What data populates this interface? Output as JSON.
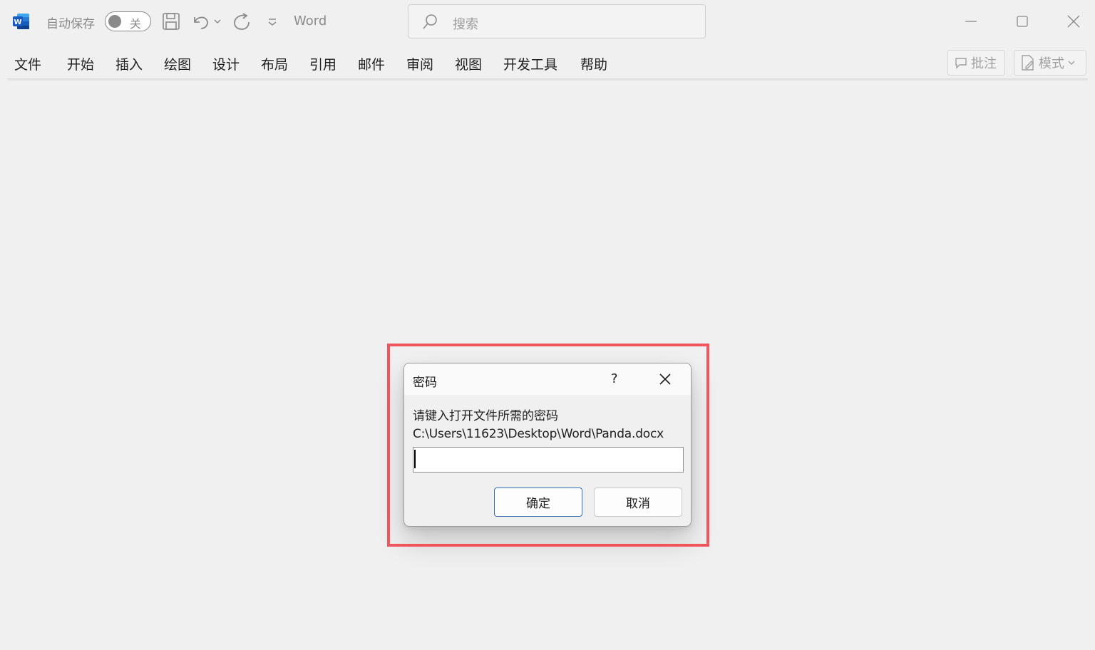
{
  "titlebar": {
    "autosave_label": "自动保存",
    "autosave_state": "关",
    "app_name": "Word",
    "search_placeholder": "搜索"
  },
  "tabs": [
    {
      "label": "文件"
    },
    {
      "label": "开始"
    },
    {
      "label": "插入"
    },
    {
      "label": "绘图"
    },
    {
      "label": "设计"
    },
    {
      "label": "布局"
    },
    {
      "label": "引用"
    },
    {
      "label": "邮件"
    },
    {
      "label": "审阅"
    },
    {
      "label": "视图"
    },
    {
      "label": "开发工具"
    },
    {
      "label": "帮助"
    }
  ],
  "ribbon_right": {
    "comments_label": "批注",
    "mode_label": "模式"
  },
  "dialog": {
    "title": "密码",
    "help": "?",
    "prompt": "请键入打开文件所需的密码",
    "path": "C:\\Users\\11623\\Desktop\\Word\\Panda.docx",
    "password_value": "",
    "ok_label": "确定",
    "cancel_label": "取消"
  },
  "colors": {
    "highlight": "#f0545c",
    "word_blue": "#185abd",
    "primary_border": "#2f6db5"
  }
}
